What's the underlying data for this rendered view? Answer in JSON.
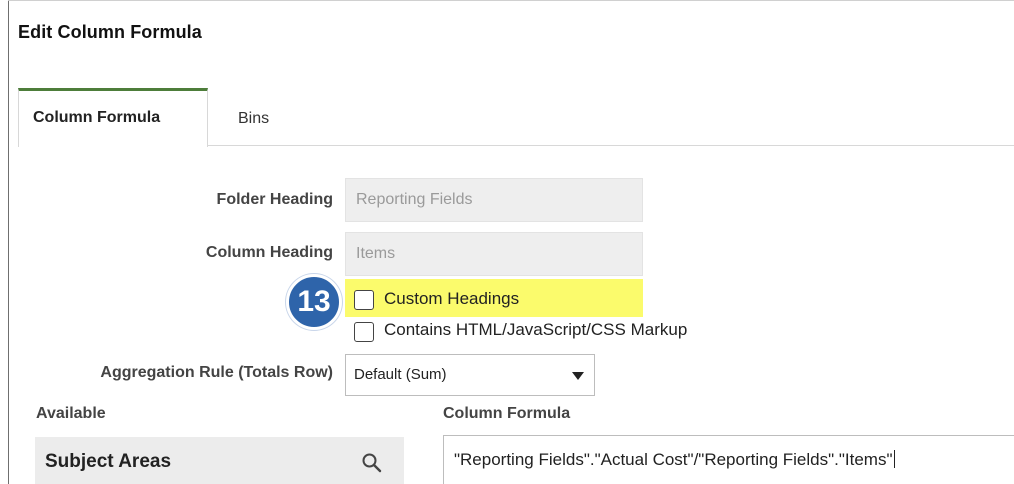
{
  "dialog": {
    "title": "Edit Column Formula"
  },
  "tabs": [
    {
      "label": "Column Formula",
      "active": true
    },
    {
      "label": "Bins",
      "active": false
    }
  ],
  "form": {
    "folder_heading": {
      "label": "Folder Heading",
      "value": "Reporting Fields"
    },
    "column_heading": {
      "label": "Column Heading",
      "value": "Items"
    },
    "custom_headings": {
      "label": "Custom Headings",
      "checked": false
    },
    "contains_markup": {
      "label": "Contains HTML/JavaScript/CSS Markup",
      "checked": false
    },
    "aggregation_rule": {
      "label": "Aggregation Rule (Totals Row)",
      "selected": "Default (Sum)"
    }
  },
  "available": {
    "label": "Available",
    "panel_title": "Subject Areas",
    "search_icon": "search-icon"
  },
  "column_formula": {
    "label": "Column Formula",
    "value": "\"Reporting Fields\".\"Actual Cost\"/\"Reporting Fields\".\"Items\""
  },
  "annotation": {
    "step_number": "13",
    "badge_color": "#2e64aa",
    "highlight_color": "#fbfb6c"
  },
  "colors": {
    "active_tab_accent": "#4d7d3a"
  }
}
